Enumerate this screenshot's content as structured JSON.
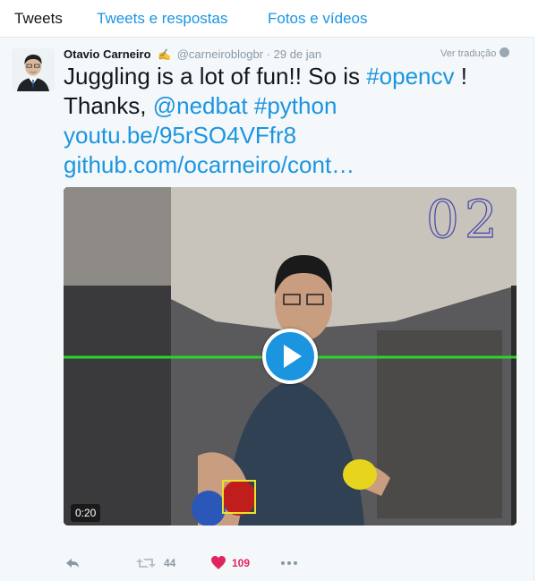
{
  "tabs": [
    {
      "label": "Tweets",
      "active": true
    },
    {
      "label": "Tweets e respostas",
      "active": false
    },
    {
      "label": "Fotos e vídeos",
      "active": false
    }
  ],
  "tweet": {
    "author_name": "Otavio Carneiro",
    "handle": "@carneiroblogbr",
    "separator": "·",
    "date": "29 de jan",
    "translate_label": "Ver tradução",
    "text_parts": {
      "p1": "Juggling is a lot of fun!! So is ",
      "hashtag_opencv": "#opencv",
      "p2": " ! Thanks, ",
      "mention_nedbat": "@nedbat",
      "hashtag_python": "#python",
      "link_youtube": "youtu.be/95rSO4VFfr8",
      "link_github": "github.com/ocarneiro/cont…"
    },
    "media": {
      "duration": "0:20",
      "overlay_text": "02"
    },
    "actions": {
      "retweet_count": "44",
      "like_count": "109"
    }
  },
  "colors": {
    "link": "#1b95e0",
    "like": "#e0245e",
    "muted": "#8899a6",
    "line": "#2bd42b"
  },
  "icons": [
    "reply-icon",
    "retweet-icon",
    "heart-icon",
    "more-icon",
    "verified-icon",
    "globe-icon",
    "play-icon"
  ]
}
